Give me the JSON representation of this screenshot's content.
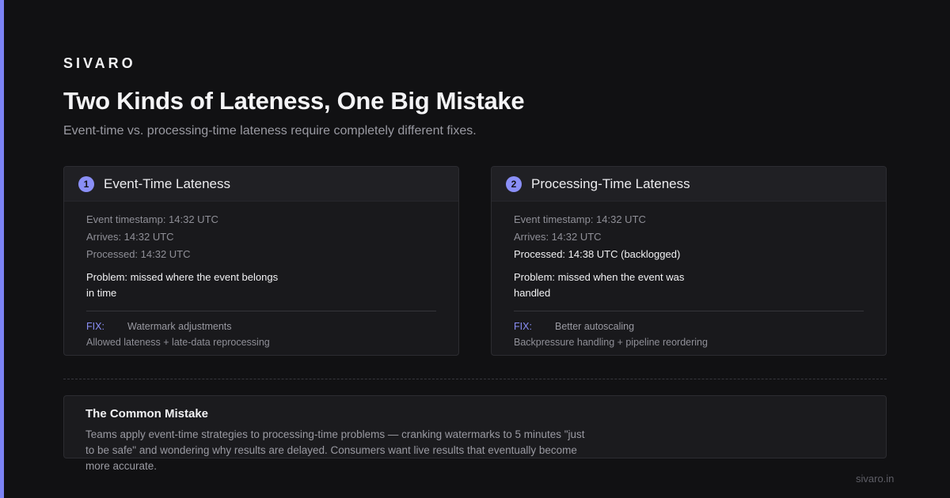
{
  "brand": "SIVARO",
  "title": "Two Kinds of Lateness, One Big Mistake",
  "subtitle": "Event-time vs. processing-time lateness require completely different fixes.",
  "cards": [
    {
      "number": "1",
      "title": "Event-Time Lateness",
      "lines": [
        "Event timestamp: 14:32 UTC",
        "Arrives: 14:32 UTC",
        "Processed: 14:32 UTC"
      ],
      "problem": "Problem: missed where the event belongs in time",
      "fix_label": "FIX:",
      "fix_main": "Watermark adjustments",
      "fix_extra": "Allowed lateness + late-data reprocessing"
    },
    {
      "number": "2",
      "title": "Processing-Time Lateness",
      "lines": [
        "Event timestamp: 14:32 UTC",
        "Arrives: 14:32 UTC",
        "Processed: 14:38 UTC (backlogged)"
      ],
      "problem": "Problem: missed when the event was handled",
      "fix_label": "FIX:",
      "fix_main": "Better autoscaling",
      "fix_extra": "Backpressure handling + pipeline reordering"
    }
  ],
  "mistake": {
    "title": "The Common Mistake",
    "body": "Teams apply event-time strategies to processing-time problems — cranking watermarks to 5 minutes \"just to be safe\" and wondering why results are delayed. Consumers want live results that eventually become more accurate."
  },
  "footer": "sivaro.in",
  "colors": {
    "background": "#111113",
    "accent": "#7c83f5",
    "badge": "#8a8ff7",
    "card": "#19191c"
  }
}
